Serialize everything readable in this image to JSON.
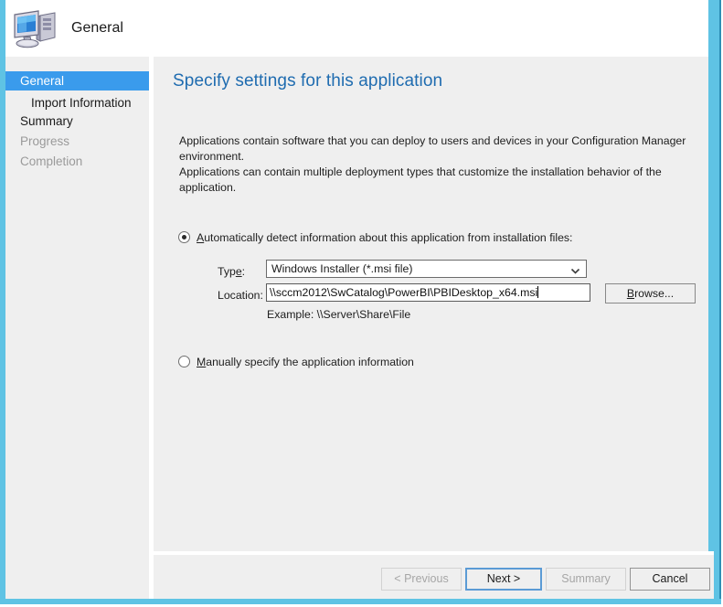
{
  "window": {
    "title": "General",
    "icon": "computer-icon",
    "accent_color": "#5fc3e4",
    "chrome_background": "#efefef"
  },
  "sidebar": {
    "items": [
      {
        "label": "General",
        "state": "selected",
        "indented": false
      },
      {
        "label": "Import Information",
        "state": "normal",
        "indented": true
      },
      {
        "label": "Summary",
        "state": "normal",
        "indented": false
      },
      {
        "label": "Progress",
        "state": "disabled",
        "indented": false
      },
      {
        "label": "Completion",
        "state": "disabled",
        "indented": false
      }
    ],
    "selected_background": "#3a9bec"
  },
  "main": {
    "heading": "Specify settings for this application",
    "heading_color": "#1f6cb0",
    "intro_line1": "Applications contain software that you can deploy to users and devices in your Configuration Manager environment.",
    "intro_line2": "Applications can contain multiple deployment types that customize the installation behavior of the application.",
    "options": {
      "automatic": {
        "label_prefix": "A",
        "label_rest": "utomatically detect information about this application from installation files:",
        "selected": true
      },
      "manual": {
        "label_prefix": "M",
        "label_rest": "anually specify the application information",
        "selected": false
      }
    },
    "fields": {
      "type": {
        "label_prefix": "Typ",
        "label_accel": "e",
        "label_suffix": ":",
        "value": "Windows Installer (*.msi file)",
        "chevron": "chevron-down-icon"
      },
      "location": {
        "label": "Location:",
        "value": "\\\\sccm2012\\SwCatalog\\PowerBI\\PBIDesktop_x64.msi",
        "example": "Example: \\\\Server\\Share\\File"
      },
      "browse": {
        "label_prefix": "B",
        "label_rest": "rowse..."
      }
    }
  },
  "footer": {
    "buttons": [
      {
        "label": "< Previous",
        "accel": "P",
        "state": "disabled"
      },
      {
        "label": "Next >",
        "accel": "N",
        "state": "focused"
      },
      {
        "label": "Summary",
        "accel": "S",
        "state": "disabled"
      },
      {
        "label": "Cancel",
        "accel": "",
        "state": "enabled"
      }
    ]
  }
}
